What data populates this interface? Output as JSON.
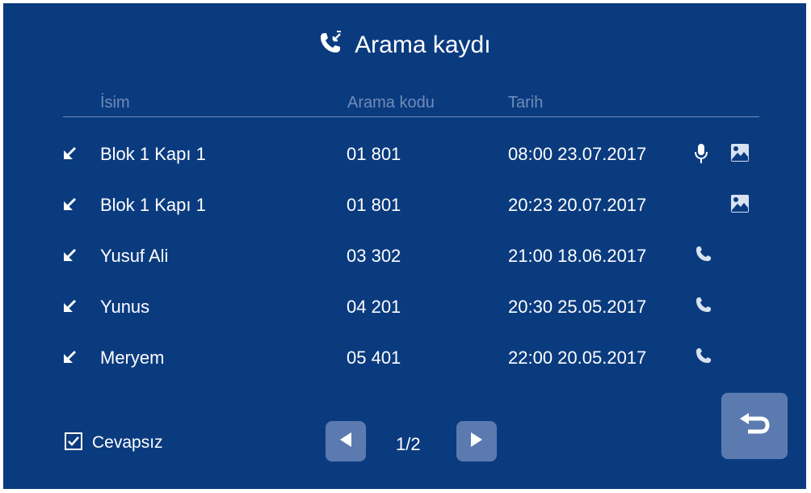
{
  "title": "Arama kaydı",
  "columns": {
    "name": "İsim",
    "code": "Arama kodu",
    "date": "Tarih"
  },
  "rows": [
    {
      "direction_icon": "incoming-arrow-icon",
      "name": "Blok 1 Kapı 1",
      "code": "01 801",
      "datetime": "08:00 23.07.2017",
      "icons": [
        "microphone-icon",
        "image-icon"
      ]
    },
    {
      "direction_icon": "incoming-arrow-icon",
      "name": "Blok 1 Kapı 1",
      "code": "01 801",
      "datetime": "20:23 20.07.2017",
      "icons": [
        "image-icon"
      ]
    },
    {
      "direction_icon": "incoming-arrow-icon",
      "name": "Yusuf Ali",
      "code": "03 302",
      "datetime": "21:00 18.06.2017",
      "icons": [
        "phone-icon"
      ]
    },
    {
      "direction_icon": "incoming-arrow-icon",
      "name": "Yunus",
      "code": "04 201",
      "datetime": "20:30 25.05.2017",
      "icons": [
        "phone-icon"
      ]
    },
    {
      "direction_icon": "incoming-arrow-icon",
      "name": "Meryem",
      "code": "05 401",
      "datetime": "22:00 20.05.2017",
      "icons": [
        "phone-icon"
      ]
    }
  ],
  "footer": {
    "missed_filter_label": "Cevapsız",
    "missed_filter_checked": true,
    "page_indicator": "1/2"
  },
  "colors": {
    "background": "#0b3b7f",
    "header_text": "#6f8cb9",
    "button": "#5b7bb0"
  }
}
